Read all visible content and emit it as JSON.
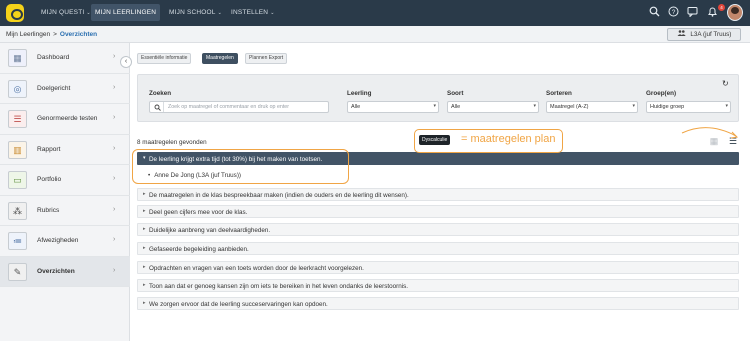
{
  "topnav": {
    "items": [
      {
        "label": "MIJN QUESTI",
        "chevron": "⌄"
      },
      {
        "label": "MIJN LEERLINGEN",
        "chevron": ""
      },
      {
        "label": "MIJN SCHOOL",
        "chevron": "⌄"
      },
      {
        "label": "INSTELLEN",
        "chevron": "⌄"
      }
    ],
    "notification_count": "4",
    "icons": [
      "search-icon",
      "help-icon",
      "chat-icon",
      "bell-icon"
    ]
  },
  "breadcrumb": {
    "root": "Mijn Leerlingen",
    "separator": ">",
    "current": "Overzichten"
  },
  "class_button": {
    "label": "L3A (juf Truus)",
    "icon": "group-icon"
  },
  "sidebar": {
    "items": [
      {
        "label": "Dashboard",
        "icon": "grid-icon",
        "glyph": "▦"
      },
      {
        "label": "Doelgericht",
        "icon": "target-icon",
        "glyph": "◎"
      },
      {
        "label": "Genormeerde testen",
        "icon": "list-icon",
        "glyph": "☰"
      },
      {
        "label": "Rapport",
        "icon": "chart-icon",
        "glyph": "▥"
      },
      {
        "label": "Portfolio",
        "icon": "folder-icon",
        "glyph": "▭"
      },
      {
        "label": "Rubrics",
        "icon": "network-icon",
        "glyph": "⁂"
      },
      {
        "label": "Afwezigheden",
        "icon": "checklist-icon",
        "glyph": "≔"
      },
      {
        "label": "Overzichten",
        "icon": "tools-icon",
        "glyph": "✎"
      }
    ],
    "active": "Overzichten"
  },
  "tabs": [
    {
      "label": "Essentiële informatie",
      "active": false
    },
    {
      "label": "Maatregelen",
      "active": true
    },
    {
      "label": "Plannen Export",
      "active": false
    }
  ],
  "filters": {
    "search": {
      "label": "Zoeken",
      "placeholder": "Zoek op maatregel of commentaar en druk op enter"
    },
    "leerling": {
      "label": "Leerling",
      "value": "Alle"
    },
    "soort": {
      "label": "Soort",
      "value": "Alle"
    },
    "sorteren": {
      "label": "Sorteren",
      "value": "Maatregel (A-Z)"
    },
    "groep": {
      "label": "Groep(en)",
      "value": "Huidige groep"
    }
  },
  "results": {
    "count_text": "8 maatregelen gevonden",
    "rows": [
      "De leerling krijgt extra tijd (tot 30%) bij het maken van toetsen.",
      "De maatregelen in de klas bespreekbaar maken (indien de ouders en de leerling dit wensen).",
      "Deel geen cijfers mee voor de klas.",
      "Duidelijke aanbreng van deelvaardigheden.",
      "Gefaseerde begeleiding aanbieden.",
      "Opdrachten en vragen van een toets worden door de leerkracht voorgelezen.",
      "Toon aan dat er genoeg kansen zijn om iets te bereiken in het leven ondanks de leerstoornis.",
      "We zorgen ervoor dat de leerling succeservaringen kan opdoen."
    ],
    "expanded_student": "Anne De Jong (L3A (juf Truus))"
  },
  "annotation": {
    "tooltip": "Dyscalculie",
    "text": "= maatregelen plan",
    "color": "#f0a545"
  }
}
